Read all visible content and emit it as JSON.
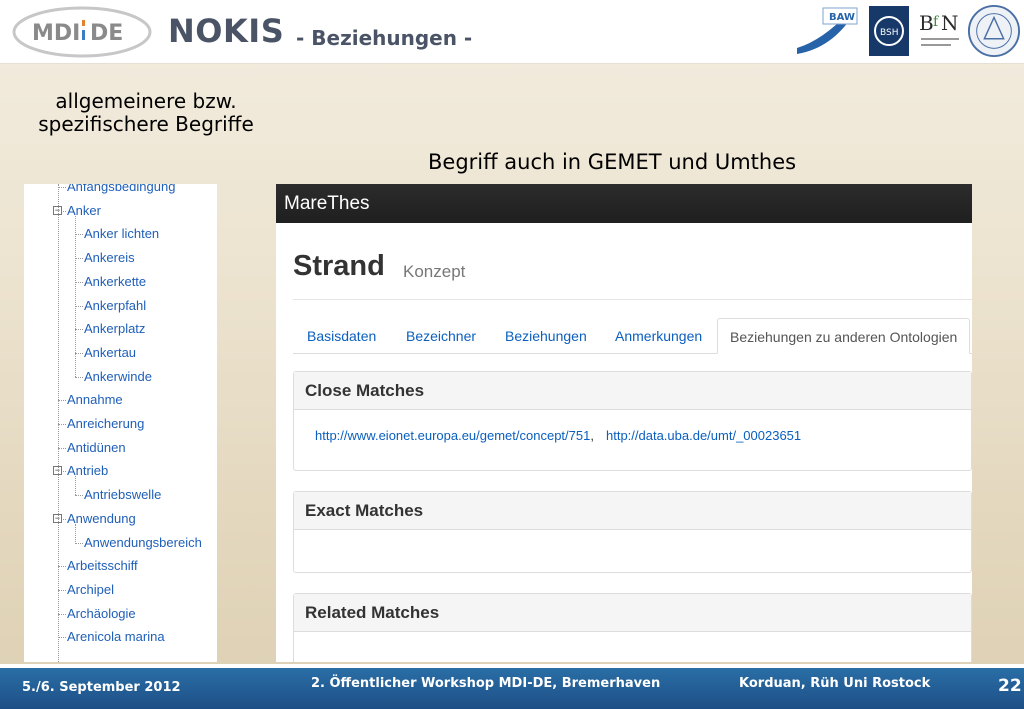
{
  "header": {
    "logo_text": "MDI-DE",
    "title": "NOKIS",
    "subtitle": "- Beziehungen -",
    "partner_logos": [
      "BAW",
      "BSH",
      "BfN",
      "Universität Rostock"
    ]
  },
  "captions": {
    "left": "allgemeinere bzw. spezifischere Begriffe",
    "right": "Begriff auch in GEMET und Umthes"
  },
  "tree": {
    "items": [
      {
        "label": "Anfangsbedingung",
        "level": 1,
        "toggle": ""
      },
      {
        "label": "Anker",
        "level": 1,
        "toggle": "−"
      },
      {
        "label": "Anker lichten",
        "level": 2,
        "toggle": ""
      },
      {
        "label": "Ankereis",
        "level": 2,
        "toggle": ""
      },
      {
        "label": "Ankerkette",
        "level": 2,
        "toggle": ""
      },
      {
        "label": "Ankerpfahl",
        "level": 2,
        "toggle": ""
      },
      {
        "label": "Ankerplatz",
        "level": 2,
        "toggle": ""
      },
      {
        "label": "Ankertau",
        "level": 2,
        "toggle": ""
      },
      {
        "label": "Ankerwinde",
        "level": 2,
        "toggle": ""
      },
      {
        "label": "Annahme",
        "level": 1,
        "toggle": ""
      },
      {
        "label": "Anreicherung",
        "level": 1,
        "toggle": ""
      },
      {
        "label": "Antidünen",
        "level": 1,
        "toggle": ""
      },
      {
        "label": "Antrieb",
        "level": 1,
        "toggle": "−"
      },
      {
        "label": "Antriebswelle",
        "level": 2,
        "toggle": ""
      },
      {
        "label": "Anwendung",
        "level": 1,
        "toggle": "−"
      },
      {
        "label": "Anwendungsbereich",
        "level": 2,
        "toggle": ""
      },
      {
        "label": "Arbeitsschiff",
        "level": 1,
        "toggle": ""
      },
      {
        "label": "Archipel",
        "level": 1,
        "toggle": ""
      },
      {
        "label": "Archäologie",
        "level": 1,
        "toggle": ""
      },
      {
        "label": "Arenicola marina",
        "level": 1,
        "toggle": ""
      }
    ]
  },
  "marethes": {
    "app_title": "MareThes",
    "term": "Strand",
    "term_kind": "Konzept",
    "tabs": [
      "Basisdaten",
      "Bezeichner",
      "Beziehungen",
      "Anmerkungen",
      "Beziehungen zu anderen Ontologien"
    ],
    "active_tab": "Beziehungen zu anderen Ontologien",
    "sections": {
      "close_matches": {
        "title": "Close Matches",
        "links": [
          "http://www.eionet.europa.eu/gemet/concept/751",
          "http://data.uba.de/umt/_00023651"
        ],
        "separator": ","
      },
      "exact_matches": {
        "title": "Exact Matches"
      },
      "related_matches": {
        "title": "Related Matches"
      }
    }
  },
  "footer": {
    "date": "5./6. September 2012",
    "event": "2. Öffentlicher Workshop MDI-DE, Bremerhaven",
    "authors": "Korduan, Rüh Uni Rostock",
    "page": "22"
  },
  "colors": {
    "link": "#1f5fb8",
    "footer_bg": "#1d4f86",
    "title": "#4a5466"
  }
}
